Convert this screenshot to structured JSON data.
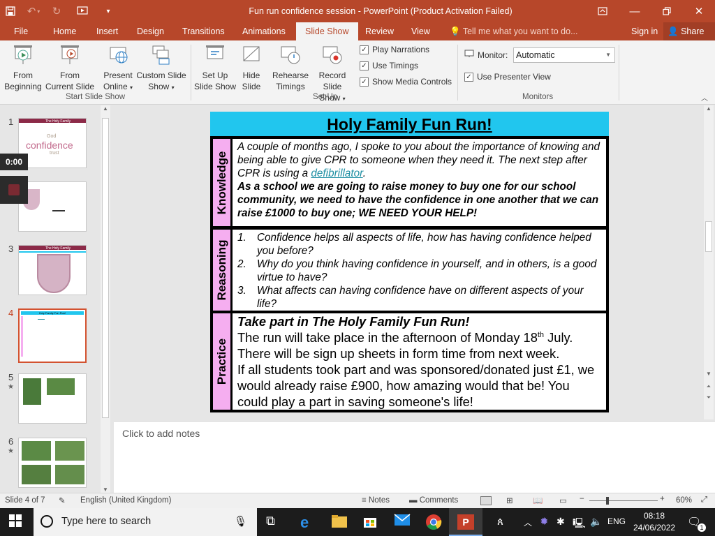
{
  "window": {
    "title": "Fun run confidence session - PowerPoint (Product Activation Failed)"
  },
  "tabs": [
    "File",
    "Home",
    "Insert",
    "Design",
    "Transitions",
    "Animations",
    "Slide Show",
    "Review",
    "View"
  ],
  "tell_me": "Tell me what you want to do...",
  "account": {
    "sign_in": "Sign in",
    "share": "Share"
  },
  "ribbon": {
    "start": {
      "group_label": "Start Slide Show",
      "from_beginning": [
        "From",
        "Beginning"
      ],
      "from_current": [
        "From",
        "Current Slide"
      ],
      "present_online": [
        "Present",
        "Online"
      ],
      "custom_show": [
        "Custom Slide",
        "Show"
      ]
    },
    "setup": {
      "group_label": "Set Up",
      "setup_show": [
        "Set Up",
        "Slide Show"
      ],
      "hide_slide": [
        "Hide",
        "Slide"
      ],
      "rehearse": [
        "Rehearse",
        "Timings"
      ],
      "record": [
        "Record Slide",
        "Show"
      ],
      "play_narrations": "Play Narrations",
      "use_timings": "Use Timings",
      "show_media_controls": "Show Media Controls"
    },
    "monitors": {
      "group_label": "Monitors",
      "monitor_label": "Monitor:",
      "monitor_value": "Automatic",
      "presenter_view": "Use Presenter View"
    }
  },
  "thumbnails": {
    "numbers": [
      "1",
      "2",
      "3",
      "4",
      "5",
      "6"
    ],
    "thumb1_text": "confidence",
    "thumb1_small": "God",
    "thumb1_small2": "trust",
    "thumb_header": "The Holy Family",
    "thumb4_title": "Holy Family Fun Run!"
  },
  "recorder": {
    "time": "0:00"
  },
  "slide": {
    "title": "Holy Family Fun Run!",
    "knowledge": {
      "label": "Knowledge",
      "p1_before_link": "A couple of months ago, I spoke to you about the importance of knowing and being able to give CPR to someone when they need it. The next step after CPR is using a ",
      "link": "defibrillator",
      "p1_after_link": ".",
      "p2": "As a school we are going to raise money to buy one for our school community, we need to have the confidence in one another that we can raise £1000 to buy one; WE NEED YOUR HELP!"
    },
    "reasoning": {
      "label": "Reasoning",
      "items": [
        {
          "n": "1.",
          "text": "Confidence helps all aspects of life, how has having confidence helped you before?"
        },
        {
          "n": "2.",
          "text": "Why do you think having confidence in yourself, and in others, is a good virtue to have?"
        },
        {
          "n": "3.",
          "text": "What affects can having confidence have on different aspects of your life?"
        }
      ]
    },
    "practice": {
      "label": "Practice",
      "heading": "Take part in The Holy Family Fun Run!",
      "line1_before": "The run will take place in the afternoon of Monday 18",
      "line1_sup": "th",
      "line1_after": " July.",
      "line2": "There will be sign up sheets in form time from next week.",
      "line3": "If all students took part and was sponsored/donated just £1, we would already raise £900, how amazing would that be! You could play a part in saving someone's life!"
    }
  },
  "notes_placeholder": "Click to add notes",
  "status": {
    "slide": "Slide 4 of 7",
    "language": "English (United Kingdom)",
    "notes": "Notes",
    "comments": "Comments",
    "zoom": "60%"
  },
  "taskbar": {
    "search": "Type here to search",
    "lang": "ENG",
    "time": "08:18",
    "date": "24/06/2022",
    "notif_count": "1"
  }
}
